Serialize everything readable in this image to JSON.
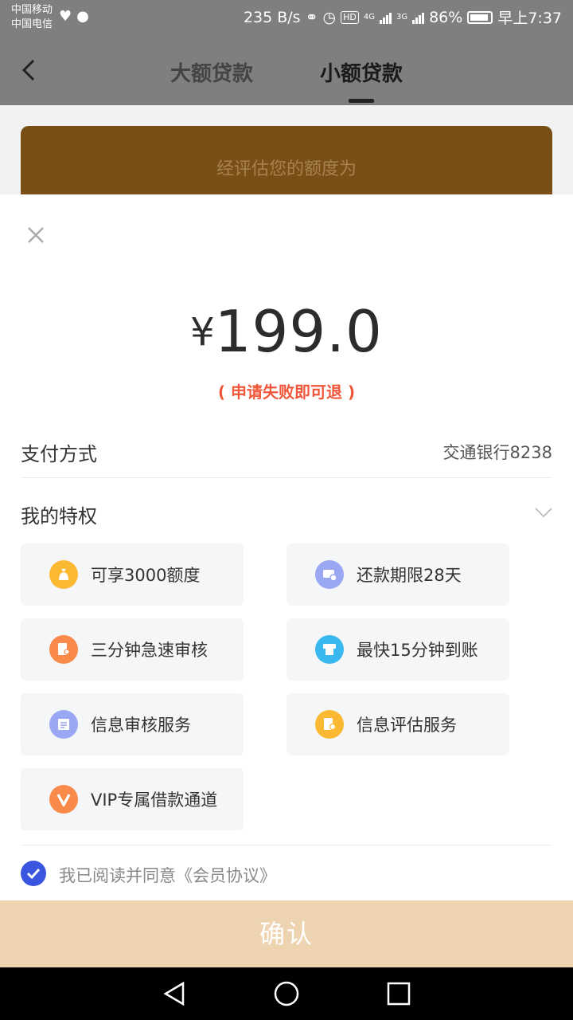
{
  "status_bar": {
    "carrier1": "中国移动",
    "carrier2": "中国电信",
    "speed": "235 B/s",
    "hd": "HD",
    "net1": "4G",
    "net2": "3G",
    "battery": "86%",
    "time": "早上7:37"
  },
  "nav": {
    "tabs": [
      "大额贷款",
      "小额贷款"
    ],
    "active_tab": "小额贷款"
  },
  "banner": {
    "text": "经评估您的额度为"
  },
  "sheet": {
    "currency": "¥",
    "amount": "199.0",
    "refund_note": "( 申请失败即可退 )",
    "payment_label": "支付方式",
    "payment_value": "交通银行8238",
    "privilege_label": "我的特权",
    "privileges": [
      {
        "label": "可享3000额度",
        "icon": "moneybag-icon",
        "color": "#fbb933"
      },
      {
        "label": "还款期限28天",
        "icon": "card-clock-icon",
        "color": "#9aa7f2"
      },
      {
        "label": "三分钟急速审核",
        "icon": "document-user-icon",
        "color": "#f98a4a"
      },
      {
        "label": "最快15分钟到账",
        "icon": "atm-icon",
        "color": "#38b8ef"
      },
      {
        "label": "信息审核服务",
        "icon": "info-list-icon",
        "color": "#9aa7f2"
      },
      {
        "label": "信息评估服务",
        "icon": "doc-check-icon",
        "color": "#fbb933"
      },
      {
        "label": "VIP专属借款通道",
        "icon": "vip-v-icon",
        "color": "#f98a4a"
      }
    ],
    "agreement": "我已阅读并同意《会员协议》",
    "confirm_label": "确认"
  },
  "colors": {
    "accent_blue": "#3a55e0",
    "refund_red": "#f0573a",
    "confirm_bg": "#eed3b0",
    "banner_bg": "#7a4f16"
  }
}
